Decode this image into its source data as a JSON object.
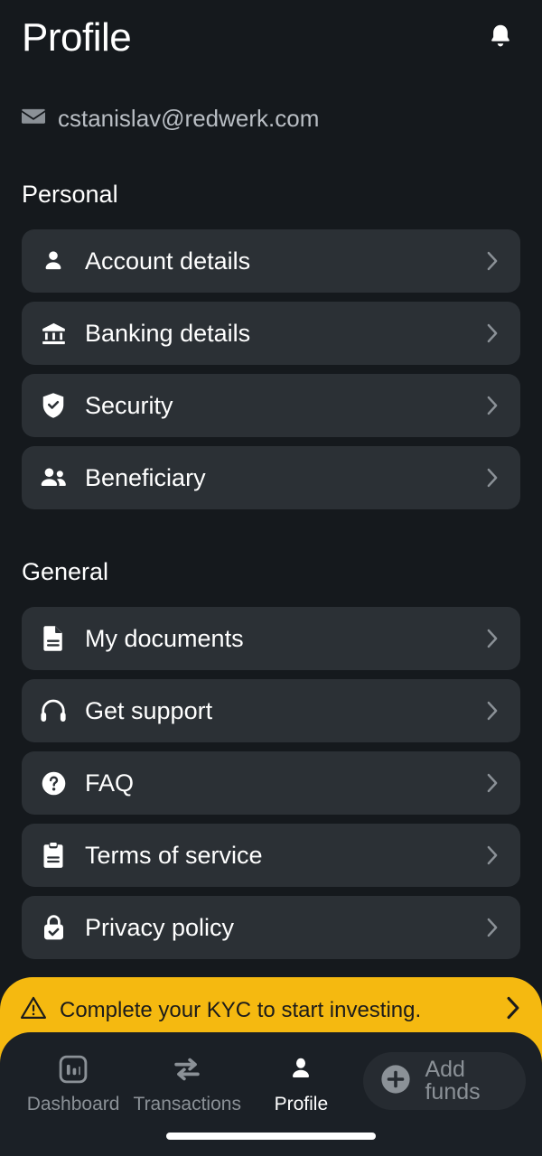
{
  "header": {
    "title": "Profile",
    "bell_icon": "bell-icon"
  },
  "account": {
    "email": "cstanislav@redwerk.com",
    "email_icon": "envelope-icon"
  },
  "sections": [
    {
      "title": "Personal",
      "items": [
        {
          "label": "Account details",
          "icon": "person-icon"
        },
        {
          "label": "Banking details",
          "icon": "bank-icon"
        },
        {
          "label": "Security",
          "icon": "shield-check-icon"
        },
        {
          "label": "Beneficiary",
          "icon": "people-icon"
        }
      ]
    },
    {
      "title": "General",
      "items": [
        {
          "label": "My documents",
          "icon": "document-icon"
        },
        {
          "label": "Get support",
          "icon": "headset-icon"
        },
        {
          "label": "FAQ",
          "icon": "help-circle-icon"
        },
        {
          "label": "Terms of service",
          "icon": "clipboard-icon"
        },
        {
          "label": "Privacy policy",
          "icon": "lock-check-icon"
        }
      ]
    }
  ],
  "kyc_banner": {
    "message": "Complete your KYC to start investing.",
    "warning_icon": "warning-triangle-icon",
    "chevron_icon": "chevron-right-icon",
    "background_color": "#f5b910",
    "text_color": "#1b1b1b"
  },
  "bottom_nav": {
    "items": [
      {
        "label": "Dashboard",
        "icon": "bar-chart-icon",
        "active": false
      },
      {
        "label": "Transactions",
        "icon": "swap-arrows-icon",
        "active": false
      },
      {
        "label": "Profile",
        "icon": "person-icon",
        "active": true
      }
    ],
    "add_funds": {
      "label": "Add funds",
      "icon": "plus-circle-icon"
    }
  },
  "colors": {
    "page_background": "#15191d",
    "card_background": "#2b3035",
    "nav_background": "#1b2026",
    "accent_yellow": "#f5b910",
    "muted_text": "#8b9197"
  }
}
